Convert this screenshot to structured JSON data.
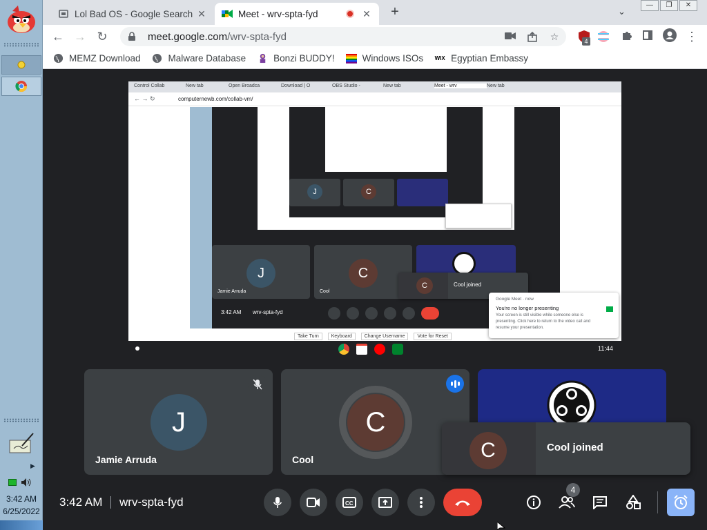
{
  "taskbar": {
    "time": "3:42 AM",
    "date": "6/25/2022"
  },
  "browser": {
    "tabs": [
      {
        "title": "Lol Bad OS - Google Search",
        "icon": "document-icon"
      },
      {
        "title": "Meet - wrv-spta-fyd",
        "icon": "meet-icon",
        "recording": true
      }
    ],
    "url_host": "meet.google.com",
    "url_path": "/wrv-spta-fyd",
    "extension_badge": "4",
    "bookmarks": [
      {
        "label": "MEMZ Download",
        "icon": "globe-icon"
      },
      {
        "label": "Malware Database",
        "icon": "globe-icon"
      },
      {
        "label": "Bonzi BUDDY!",
        "icon": "bonzi-icon"
      },
      {
        "label": "Windows ISOs",
        "icon": "rainbow-flag-icon"
      },
      {
        "label": "Egyptian Embassy",
        "icon": "wix-icon"
      }
    ]
  },
  "presentation": {
    "inner_tabs": [
      "Control Collab",
      "New tab",
      "Open Broadca",
      "Download | O",
      "OBS Studio -",
      "New tab",
      "Meet - wrv",
      "New tab"
    ],
    "inner_url": "computernewb.com/collab-vm/",
    "inner_clock": "3:42 AM",
    "inner_code": "wrv-spta-fyd",
    "inner_tiles": [
      {
        "initial": "J",
        "name": "Jamie Arruda"
      },
      {
        "initial": "C",
        "name": "Cool"
      }
    ],
    "inner_joined": "Cool joined",
    "notification": {
      "app": "Google Meet",
      "time": "now",
      "title": "You're no longer presenting",
      "body": "Your screen is still visible while someone else is presenting. Click here to return to the video call and resume your presentation."
    },
    "vm_buttons": [
      "Take Turn",
      "Keyboard",
      "Change Username",
      "Vote for Reset"
    ],
    "shelf_time": "11:44"
  },
  "meet": {
    "tiles": [
      {
        "initial": "J",
        "name": "Jamie Arruda",
        "muted": true
      },
      {
        "initial": "C",
        "name": "Cool",
        "speaking": true
      },
      {
        "initial": "",
        "name": "OBS"
      }
    ],
    "joined_toast": {
      "initial": "C",
      "message": "Cool joined"
    },
    "clock": "3:42 AM",
    "meeting_code": "wrv-spta-fyd",
    "participants_count": "4",
    "colors": {
      "background": "#202124",
      "tile": "#3c4043",
      "hangup": "#ea4335",
      "activities": "#8ab4f8",
      "speaking": "#1a73e8"
    }
  }
}
